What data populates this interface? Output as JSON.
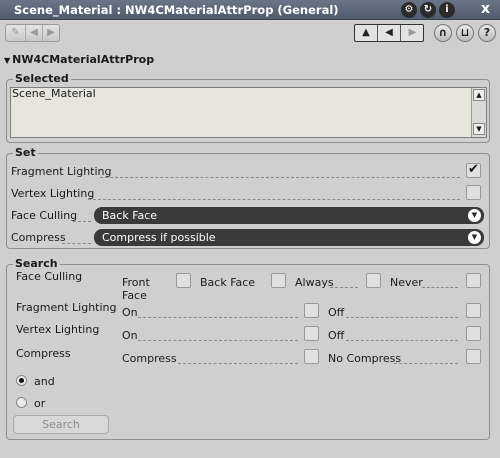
{
  "window": {
    "title": "Scene_Material : NW4CMaterialAttrProp (General)",
    "close_glyph": "x",
    "title_icons": [
      "gear-icon",
      "recycle-icon",
      "info-icon"
    ]
  },
  "toolbar": {
    "nav_icons": [
      "wrench-icon",
      "prev-icon",
      "next-icon"
    ],
    "history_icons": [
      "up-arrow-icon",
      "back-arrow-icon",
      "forward-arrow-icon"
    ],
    "right_icons": [
      "magnet-icon",
      "pin-icon",
      "help-icon"
    ],
    "help_glyph": "?"
  },
  "header": {
    "title": "NW4CMaterialAttrProp"
  },
  "selected": {
    "label": "Selected",
    "value": "Scene_Material"
  },
  "set": {
    "label": "Set",
    "fragment_lighting": {
      "label": "Fragment Lighting",
      "checked": true
    },
    "vertex_lighting": {
      "label": "Vertex Lighting",
      "checked": false
    },
    "face_culling": {
      "label": "Face Culling",
      "value": "Back Face"
    },
    "compress": {
      "label": "Compress",
      "value": "Compress if possible"
    }
  },
  "search": {
    "label": "Search",
    "face_culling": {
      "label": "Face Culling",
      "options": [
        "Front Face",
        "Back Face",
        "Always",
        "Never"
      ],
      "front_line1": "Front",
      "front_line2": "Face"
    },
    "fragment_lighting": {
      "label": "Fragment Lighting",
      "on": "On",
      "off": "Off"
    },
    "vertex_lighting": {
      "label": "Vertex Lighting",
      "on": "On",
      "off": "Off"
    },
    "compress": {
      "label": "Compress",
      "a": "Compress",
      "b": "No Compress"
    },
    "mode": {
      "and": "and",
      "or": "or",
      "selected": "and"
    },
    "button_label": "Search"
  }
}
